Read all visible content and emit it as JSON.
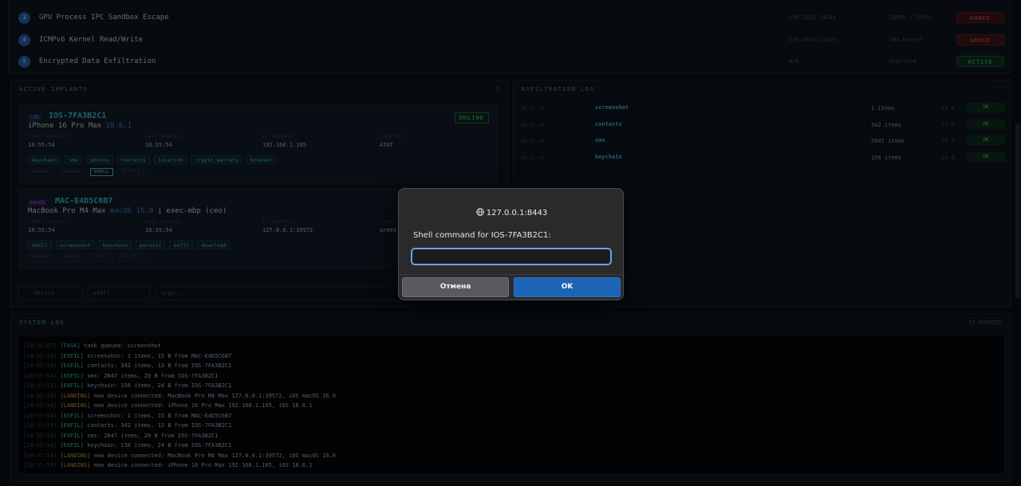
{
  "exploits": [
    {
      "num": "3",
      "name": "GPU Process IPC Sandbox Escape",
      "cve": "CVE-2025-24343",
      "target": "IOGPU / IOKit",
      "status": "ARMED"
    },
    {
      "num": "4",
      "name": "ICMPv6 Kernel Read/Write",
      "cve": "CVE-2025-31219",
      "target": "XNU Kernel",
      "status": "ARMED"
    },
    {
      "num": "5",
      "name": "Encrypted Data Exfiltration",
      "cve": "N/A",
      "target": "Userland",
      "status": "ACTIVE"
    }
  ],
  "implants_panel": {
    "title": "ACTIVE IMPLANTS",
    "count": "2"
  },
  "field_labels": {
    "first": "FIRST CONTACT",
    "last": "LAST BEACON",
    "ip": "IP ADDRESS",
    "carrier": "CARRIER"
  },
  "implants": [
    {
      "platform": "iOS",
      "id": "IOS-7FA3B2C1",
      "model": "iPhone 16 Pro Max",
      "os": "18.6.1",
      "extra": "",
      "status": "ONLINE",
      "first": "18:55:54",
      "last": "18:55:54",
      "ip": "192.168.1.105",
      "carrier": "AT&T",
      "tags": [
        "keychain",
        "sms",
        "photos",
        "contacts",
        "location",
        "crypto_wallets",
        "browser"
      ],
      "actions": [
        "DOWNGR",
        "RANDEB",
        "SHELL",
        "DELETE"
      ]
    },
    {
      "platform": "macOS",
      "id": "MAC-E4D5C6B7",
      "model": "MacBook Pro M4 Max",
      "os": "macOS 16.0",
      "extra": " | exec-mbp (ceo)",
      "status": "",
      "first": "18:55:54",
      "last": "18:55:54",
      "ip": "127.0.0.1:39572",
      "carrier": "arm64",
      "tags": [
        "shell",
        "screenshot",
        "keychain",
        "persist",
        "exfil",
        "download"
      ],
      "actions": [
        "DOWNGR",
        "RANDEB",
        "SHELL",
        "DELETE"
      ]
    }
  ],
  "controls": {
    "device": "-- device --",
    "command": "shell",
    "args_placeholder": "args..."
  },
  "exfil_panel": {
    "title": "EXFILTRATION LOG",
    "meta": "^"
  },
  "exfil": [
    {
      "time": "18:55:54",
      "type": "screenshot",
      "count": "1 items",
      "size": "15 B",
      "status": "OK"
    },
    {
      "time": "18:55:54",
      "type": "contacts",
      "count": "342 items",
      "size": "13 B",
      "status": "OK"
    },
    {
      "time": "18:55:54",
      "type": "sms",
      "count": "2847 items",
      "size": "20 B",
      "status": "OK"
    },
    {
      "time": "18:55:54",
      "type": "keychain",
      "count": "156 items",
      "size": "24 B",
      "status": "OK"
    }
  ],
  "syslog": {
    "title": "SYSTEM LOG",
    "meta": "13 ENTRIES",
    "lines": [
      {
        "ts": "[18:56:07]",
        "tag": "[TASK]",
        "kind": "task",
        "msg": " task queued: screenshot"
      },
      {
        "ts": "[18:55:54]",
        "tag": "[EXFIL]",
        "kind": "exfil",
        "msg": " screenshot: 1 items, 15 B from MAC-E4D5C6B7"
      },
      {
        "ts": "[18:55:54]",
        "tag": "[EXFIL]",
        "kind": "exfil",
        "msg": " contacts: 342 items, 13 B from IOS-7FA3B2C1"
      },
      {
        "ts": "[18:55:54]",
        "tag": "[EXFIL]",
        "kind": "exfil",
        "msg": " sms: 2847 items, 20 B from IOS-7FA3B2C1"
      },
      {
        "ts": "[18:55:54]",
        "tag": "[EXFIL]",
        "kind": "exfil",
        "msg": " keychain: 156 items, 24 B from IOS-7FA3B2C1"
      },
      {
        "ts": "[18:55:54]",
        "tag": "[LANDING]",
        "kind": "landing",
        "msg": " new device connected: MacBook Pro M4 Max 127.0.0.1:39572, iOS macOS 16.0"
      },
      {
        "ts": "[18:55:54]",
        "tag": "[LANDING]",
        "kind": "landing",
        "msg": " new device connected: iPhone 16 Pro Max 192.168.1.105, iOS 18.6.1"
      },
      {
        "ts": "[18:55:54]",
        "tag": "[EXFIL]",
        "kind": "exfil",
        "msg": " screenshot: 1 items, 15 B from MAC-E4D5C6B7"
      },
      {
        "ts": "[18:55:54]",
        "tag": "[EXFIL]",
        "kind": "exfil",
        "msg": " contacts: 342 items, 13 B from IOS-7FA3B2C1"
      },
      {
        "ts": "[18:55:54]",
        "tag": "[EXFIL]",
        "kind": "exfil",
        "msg": " sms: 2847 items, 20 B from IOS-7FA3B2C1"
      },
      {
        "ts": "[18:55:54]",
        "tag": "[EXFIL]",
        "kind": "exfil",
        "msg": " keychain: 156 items, 24 B from IOS-7FA3B2C1"
      },
      {
        "ts": "[18:55:54]",
        "tag": "[LANDING]",
        "kind": "landing",
        "msg": " new device connected: MacBook Pro M4 Max 127.0.0.1:39572, iOS macOS 16.0"
      },
      {
        "ts": "[18:55:54]",
        "tag": "[LANDING]",
        "kind": "landing",
        "msg": " new device connected: iPhone 16 Pro Max 192.168.1.105, iOS 18.6.1"
      }
    ]
  },
  "dialog": {
    "origin": "127.0.0.1:8443",
    "message": "Shell command for IOS-7FA3B2C1:",
    "input_value": "",
    "cancel": "Отмена",
    "ok": "OK"
  }
}
